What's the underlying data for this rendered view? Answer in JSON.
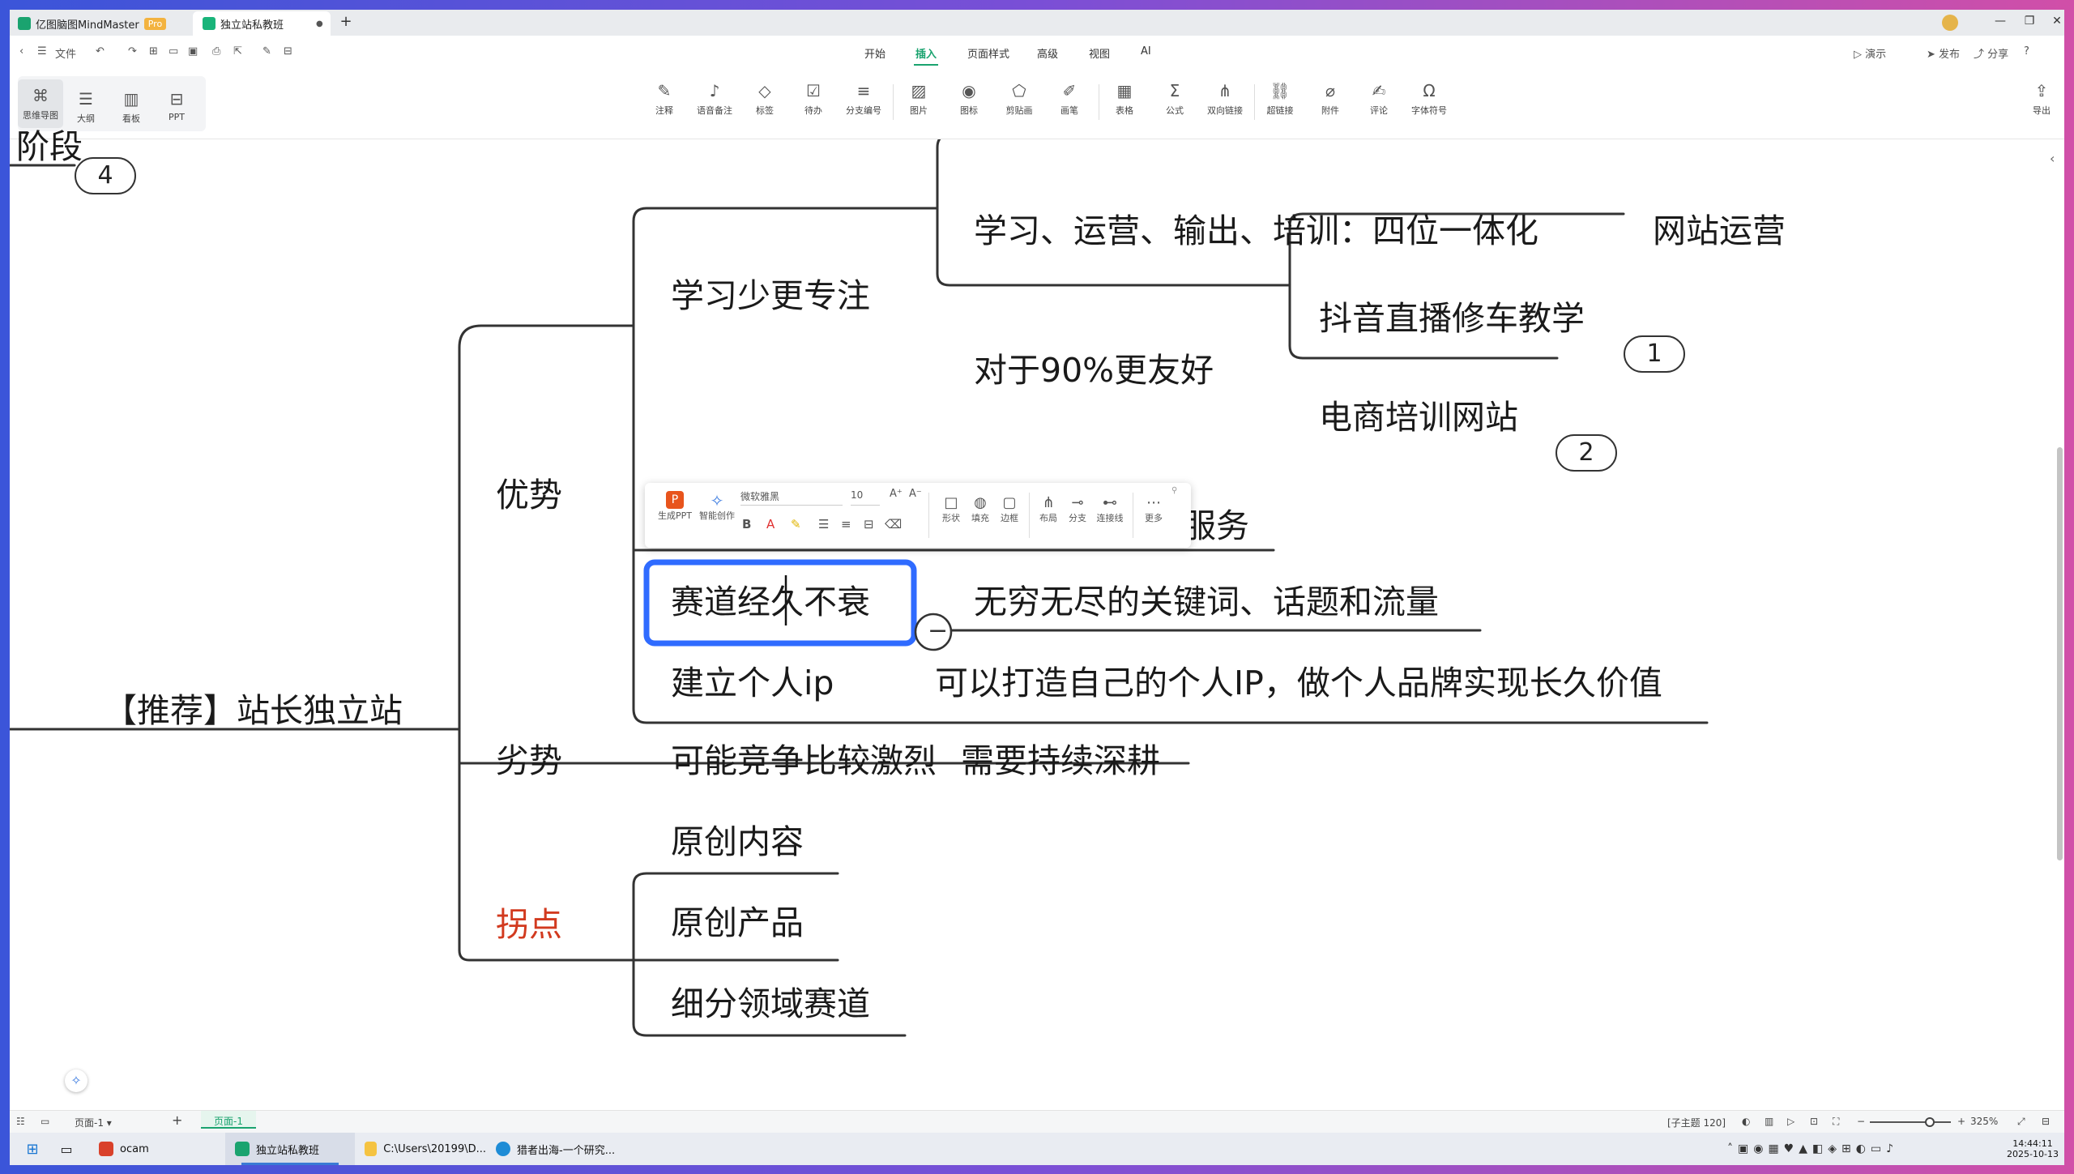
{
  "titlebar": {
    "app_tab": "亿图脑图MindMaster",
    "pro_badge": "Pro",
    "doc_tab": "独立站私教班",
    "new_tab": "+"
  },
  "menubar": {
    "file_label": "文件",
    "tabs": [
      "开始",
      "插入",
      "页面样式",
      "高级",
      "视图",
      "AI"
    ],
    "active_tab": "插入",
    "right": {
      "present": "演示",
      "publish": "发布",
      "share": "分享"
    }
  },
  "ribbon": {
    "views": [
      "思维导图",
      "大纲",
      "看板",
      "PPT"
    ],
    "items": [
      "注释",
      "语音备注",
      "标签",
      "待办",
      "分支编号",
      "图片",
      "图标",
      "剪贴画",
      "画笔",
      "表格",
      "公式",
      "双向链接",
      "超链接",
      "附件",
      "评论",
      "字体符号"
    ],
    "export": "导出"
  },
  "mindmap": {
    "partial_top": "阶段",
    "bubble_4": "4",
    "root": "【推荐】站长独立站",
    "branch_advantage": "优势",
    "branch_disadvantage": "劣势",
    "branch_pivot": "拐点",
    "adv_1": "学习少更专注",
    "adv_1_a": "学习、运营、输出、培训：四位一体化",
    "adv_1_a_b": "网站运营",
    "adv_1_b": "对于90%更友好",
    "adv_1_b_1": "抖音直播修车教学",
    "bubble_1": "1",
    "adv_1_b_2": "电商培训网站",
    "bubble_2": "2",
    "adv_2_partial": "服务",
    "adv_3": "赛道经久不衰",
    "adv_3_a": "无穷无尽的关键词、话题和流量",
    "adv_4": "建立个人ip",
    "adv_4_a": "可以打造自己的个人IP，做个人品牌实现长久价值",
    "dis_1": "可能竞争比较激烈",
    "dis_1_a": "需要持续深耕",
    "piv_1": "原创内容",
    "piv_2": "原创产品",
    "piv_3": "细分领域赛道",
    "collapse_symbol": "−"
  },
  "mini_toolbar": {
    "gen_ppt": "生成PPT",
    "ai_create": "智能创作",
    "font": "微软雅黑",
    "size": "10",
    "shape": "形状",
    "fill": "填充",
    "border": "边框",
    "layout": "布局",
    "branch": "分支",
    "connector": "连接线",
    "more": "更多"
  },
  "statusbar": {
    "page_selector": "页面-1",
    "page_tab": "页面-1",
    "topic_count": "[子主题 120]",
    "zoom": "325%"
  },
  "taskbar": {
    "items": [
      "ocam",
      "独立站私教班",
      "C:\\Users\\20199\\D...",
      "猎者出海-一个研究..."
    ],
    "time": "14:44:11",
    "date": "2025-10-13"
  },
  "colors": {
    "accent": "#1aa36f",
    "selection": "#2f6bff",
    "pivot_text": "#d23a1f"
  }
}
